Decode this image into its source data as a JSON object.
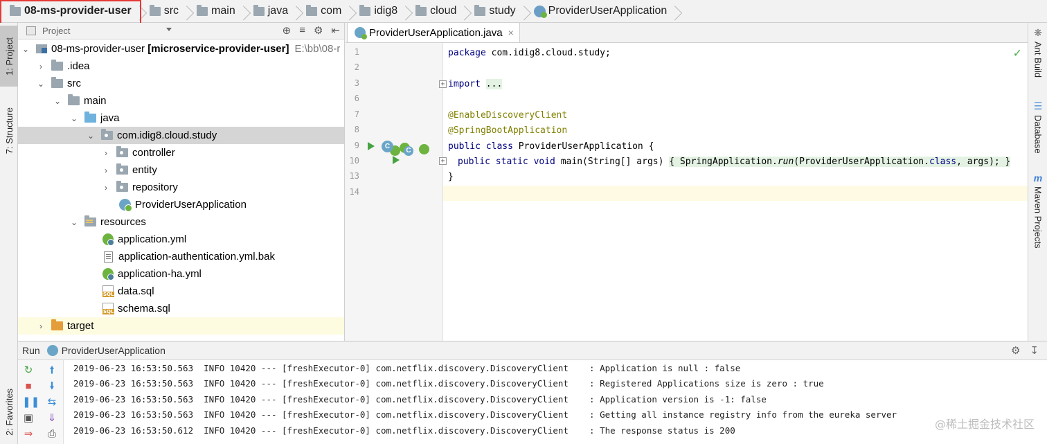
{
  "breadcrumb": {
    "items": [
      "08-ms-provider-user",
      "src",
      "main",
      "java",
      "com",
      "idig8",
      "cloud",
      "study",
      "ProviderUserApplication"
    ]
  },
  "left_strip": {
    "project_tab": "1: Project",
    "structure_tab": "7: Structure",
    "favorites_tab": "2: Favorites"
  },
  "right_strip": {
    "ant_build": "Ant Build",
    "database": "Database",
    "maven": "Maven Projects"
  },
  "project_panel": {
    "header_label": "Project",
    "tree": [
      {
        "label": "08-ms-provider-user",
        "bold_suffix": "[microservice-provider-user]",
        "path": "E:\\bb\\08-r"
      },
      {
        "label": ".idea"
      },
      {
        "label": "src"
      },
      {
        "label": "main"
      },
      {
        "label": "java"
      },
      {
        "label": "com.idig8.cloud.study"
      },
      {
        "label": "controller"
      },
      {
        "label": "entity"
      },
      {
        "label": "repository"
      },
      {
        "label": "ProviderUserApplication"
      },
      {
        "label": "resources"
      },
      {
        "label": "application.yml"
      },
      {
        "label": "application-authentication.yml.bak"
      },
      {
        "label": "application-ha.yml"
      },
      {
        "label": "data.sql"
      },
      {
        "label": "schema.sql"
      },
      {
        "label": "target"
      }
    ]
  },
  "editor": {
    "tab_label": "ProviderUserApplication.java",
    "line_numbers": [
      "1",
      "2",
      "3",
      "6",
      "7",
      "8",
      "9",
      "10",
      "13",
      "14"
    ],
    "code": {
      "l1_kw": "package",
      "l1_rest": " com.idig8.cloud.study;",
      "l3_kw": "import",
      "l3_fold": "...",
      "l7": "@EnableDiscoveryClient",
      "l8": "@SpringBootApplication",
      "l9_kw": "public class",
      "l9_rest": " ProviderUserApplication {",
      "l10_kw": "public static void",
      "l10_mid": " main(String[] args) ",
      "l10_fold_a": "{ SpringApplication.",
      "l10_run": "run",
      "l10_fold_b": "(ProviderUserApplication.",
      "l10_class": "class",
      "l10_fold_c": ", args); }",
      "l13": "}"
    }
  },
  "run_panel": {
    "label": "Run",
    "config": "ProviderUserApplication",
    "log": [
      "2019-06-23 16:53:50.563  INFO 10420 --- [freshExecutor-0] com.netflix.discovery.DiscoveryClient    : Application is null : false",
      "2019-06-23 16:53:50.563  INFO 10420 --- [freshExecutor-0] com.netflix.discovery.DiscoveryClient    : Registered Applications size is zero : true",
      "2019-06-23 16:53:50.563  INFO 10420 --- [freshExecutor-0] com.netflix.discovery.DiscoveryClient    : Application version is -1: false",
      "2019-06-23 16:53:50.563  INFO 10420 --- [freshExecutor-0] com.netflix.discovery.DiscoveryClient    : Getting all instance registry info from the eureka server",
      "2019-06-23 16:53:50.612  INFO 10420 --- [freshExecutor-0] com.netflix.discovery.DiscoveryClient    : The response status is 200"
    ]
  },
  "watermark": "@稀土掘金技术社区",
  "colors": {
    "highlight_box": "#e53935",
    "keyword": "#000080",
    "annotation": "#808000",
    "run_green": "#46a340"
  }
}
